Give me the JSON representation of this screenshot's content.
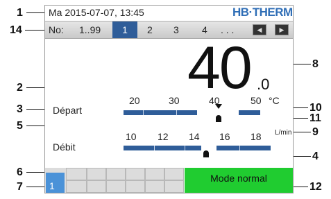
{
  "header": {
    "datetime": "Ma  2015-07-07, 13:45",
    "brand": "HB·THERM"
  },
  "nav": {
    "label": "No:",
    "range": "1..99",
    "items": [
      "1",
      "2",
      "3",
      "4"
    ],
    "more": ". . ."
  },
  "temperature": {
    "value_main": "40",
    "value_decimal": ".0"
  },
  "depart": {
    "label": "Départ",
    "unit": "°C",
    "ticks": [
      "20",
      "30",
      "40",
      "50"
    ]
  },
  "debit": {
    "label": "Débit",
    "unit": "L/min",
    "ticks": [
      "10",
      "12",
      "14",
      "16",
      "18"
    ]
  },
  "bottom": {
    "station_number": "1",
    "mode": "Mode normal"
  },
  "callouts": [
    "1",
    "14",
    "2",
    "3",
    "5",
    "6",
    "7",
    "8",
    "10",
    "11",
    "9",
    "4",
    "12"
  ],
  "colors": {
    "brand": "#2f6eb6",
    "selected": "#2f5d99",
    "mode_green": "#20cc30",
    "station_blue": "#4a92d8"
  }
}
